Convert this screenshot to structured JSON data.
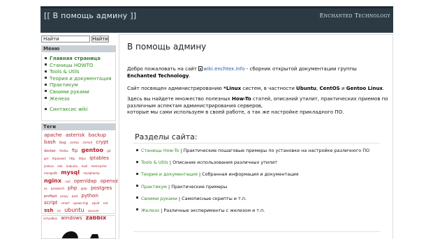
{
  "header": {
    "title": "[[ В помощь админу ]]",
    "brand": "Enchanted Technology"
  },
  "search": {
    "value": "Найти",
    "button": "Найти"
  },
  "sidebar": {
    "menu_title": "Меню",
    "menu_items": [
      {
        "label": "Главная страница"
      },
      {
        "label": "Станицы HOWTO"
      },
      {
        "label": "Tools & Utils"
      },
      {
        "label": "Теория и документация"
      },
      {
        "label": "Практикум"
      },
      {
        "label": "Своими руками"
      },
      {
        "label": "Железо"
      },
      {
        "label": "Синтаксис wiki"
      }
    ],
    "tags_title": "Теги",
    "tags": [
      "apache",
      "asterisk",
      "backup",
      "bash",
      "bug",
      "centos",
      "chmod",
      "crypt",
      "docker",
      "firefox",
      "ftp",
      "gentoo",
      "git",
      "gre",
      "htpasswd",
      "http",
      "https",
      "iptables",
      "jenkins",
      "kde",
      "kubuntu",
      "mail",
      "memcache",
      "mongodb",
      "mysql",
      "mysqldump",
      "nginx",
      "null",
      "openldap",
      "openvz",
      "os",
      "password",
      "php",
      "pptp",
      "postgres",
      "proftpd",
      "proxy",
      "pwd",
      "python",
      "script",
      "smart",
      "spawn-fcgi",
      "squid",
      "ssd",
      "ssh",
      "ssl",
      "ubuntu",
      "vaccum",
      "virtualbox",
      "windows",
      "zabbix"
    ]
  },
  "main": {
    "heading": "В помощь админу",
    "intro": {
      "welcome": "Добро пожаловать на сайт",
      "site_link": "wiki.enchtex.info",
      "after_link": " - сборник открытой документации группы ",
      "group": "Enchanted Technology",
      "end": "."
    },
    "para2": {
      "before": "Сайт посвящен администрированию ",
      "linux": "*Linux",
      "middle": " систем, в частности ",
      "ubuntu": "Ubuntu",
      "comma1": ", ",
      "centos": "CentOS",
      "and": " и ",
      "gentoo": "Gentoo Linux",
      "end": "."
    },
    "para3": {
      "before": "Здесь вы найдете множество полезных ",
      "howto": "How-To",
      "after": " статей, описаний утилит, практических приемов по различным аспектам администрирования серверов,",
      "line2": "которые мы сами используем в своей работе, а так же настройке прикладного ПО."
    },
    "sections_heading": "Разделы сайта:",
    "sections": [
      {
        "link": "Станицы How-To",
        "desc": " | Практические пошаговые примеры по установке на настройке различного ПО"
      },
      {
        "link": "Tools & Utils",
        "desc": " | Описание использования различных утилит"
      },
      {
        "link": "Теория и документация",
        "desc": " | Собранная информация и документация"
      },
      {
        "link": "Практикум",
        "desc": " | Практические примеры"
      },
      {
        "link": "Своими руками",
        "desc": " | Самописные скрипты и т.п."
      },
      {
        "link": "Железо",
        "desc": " | Различные эксперименты с железом и т.п."
      }
    ]
  },
  "colors": {
    "header_bg": "#2c3a44",
    "link_green": "#2f8f1f",
    "tag_red": "#b5202c",
    "box_title_bg": "#c9d1d6"
  }
}
